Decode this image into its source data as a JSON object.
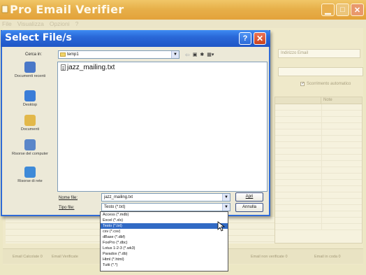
{
  "app": {
    "title": "Pro Email Verifier",
    "menu": [
      "File",
      "Visualizza",
      "Opzioni",
      "?"
    ],
    "address_header": "Indirizzo Email",
    "autoscroll_label": "Scorrimento automatico",
    "autoscroll_checked": true,
    "grid_header": "Note",
    "status": {
      "calcolate": "Email Calcolate  0",
      "verificate": "Email Verificate",
      "non_verificate": "Email non verificate  0",
      "in_coda": "Email in coda  0"
    },
    "window_buttons": {
      "close": "✕"
    }
  },
  "dialog": {
    "title": "Select File/s",
    "help_label": "?",
    "close_label": "✕",
    "look_in_label": "Cerca in:",
    "look_in_value": "temp1",
    "places": [
      {
        "label": "Documenti recenti",
        "icon": "recent-documents-icon",
        "color": "#4a78c8"
      },
      {
        "label": "Desktop",
        "icon": "desktop-icon",
        "color": "#3a7dd8"
      },
      {
        "label": "Documenti",
        "icon": "my-documents-icon",
        "color": "#e2b84a"
      },
      {
        "label": "Risorse del computer",
        "icon": "my-computer-icon",
        "color": "#5a86c9"
      },
      {
        "label": "Risorse di rete",
        "icon": "network-places-icon",
        "color": "#3e8ad8"
      }
    ],
    "files": [
      {
        "name": "jazz_mailing.txt",
        "icon": "text-file-icon"
      }
    ],
    "file_name_label": "Nome file:",
    "file_name_value": "jazz_mailing.txt",
    "file_type_label": "Tipo file:",
    "file_type_value": "Testo (*.txt)",
    "open_button": "Apri",
    "cancel_button": "Annulla",
    "file_type_options": [
      "Access (*.mdb)",
      "Excel (*.xls)",
      "Testo (*.txt)",
      "csv (*.csv)",
      "dBase (*.dbf)",
      "FoxPro (*.dbc)",
      "Lotus 1-2-3 (*.wk3)",
      "Paradox (*.db)",
      "Html (*.html)",
      "Tutti (*.*)"
    ],
    "selected_option_index": 2
  }
}
